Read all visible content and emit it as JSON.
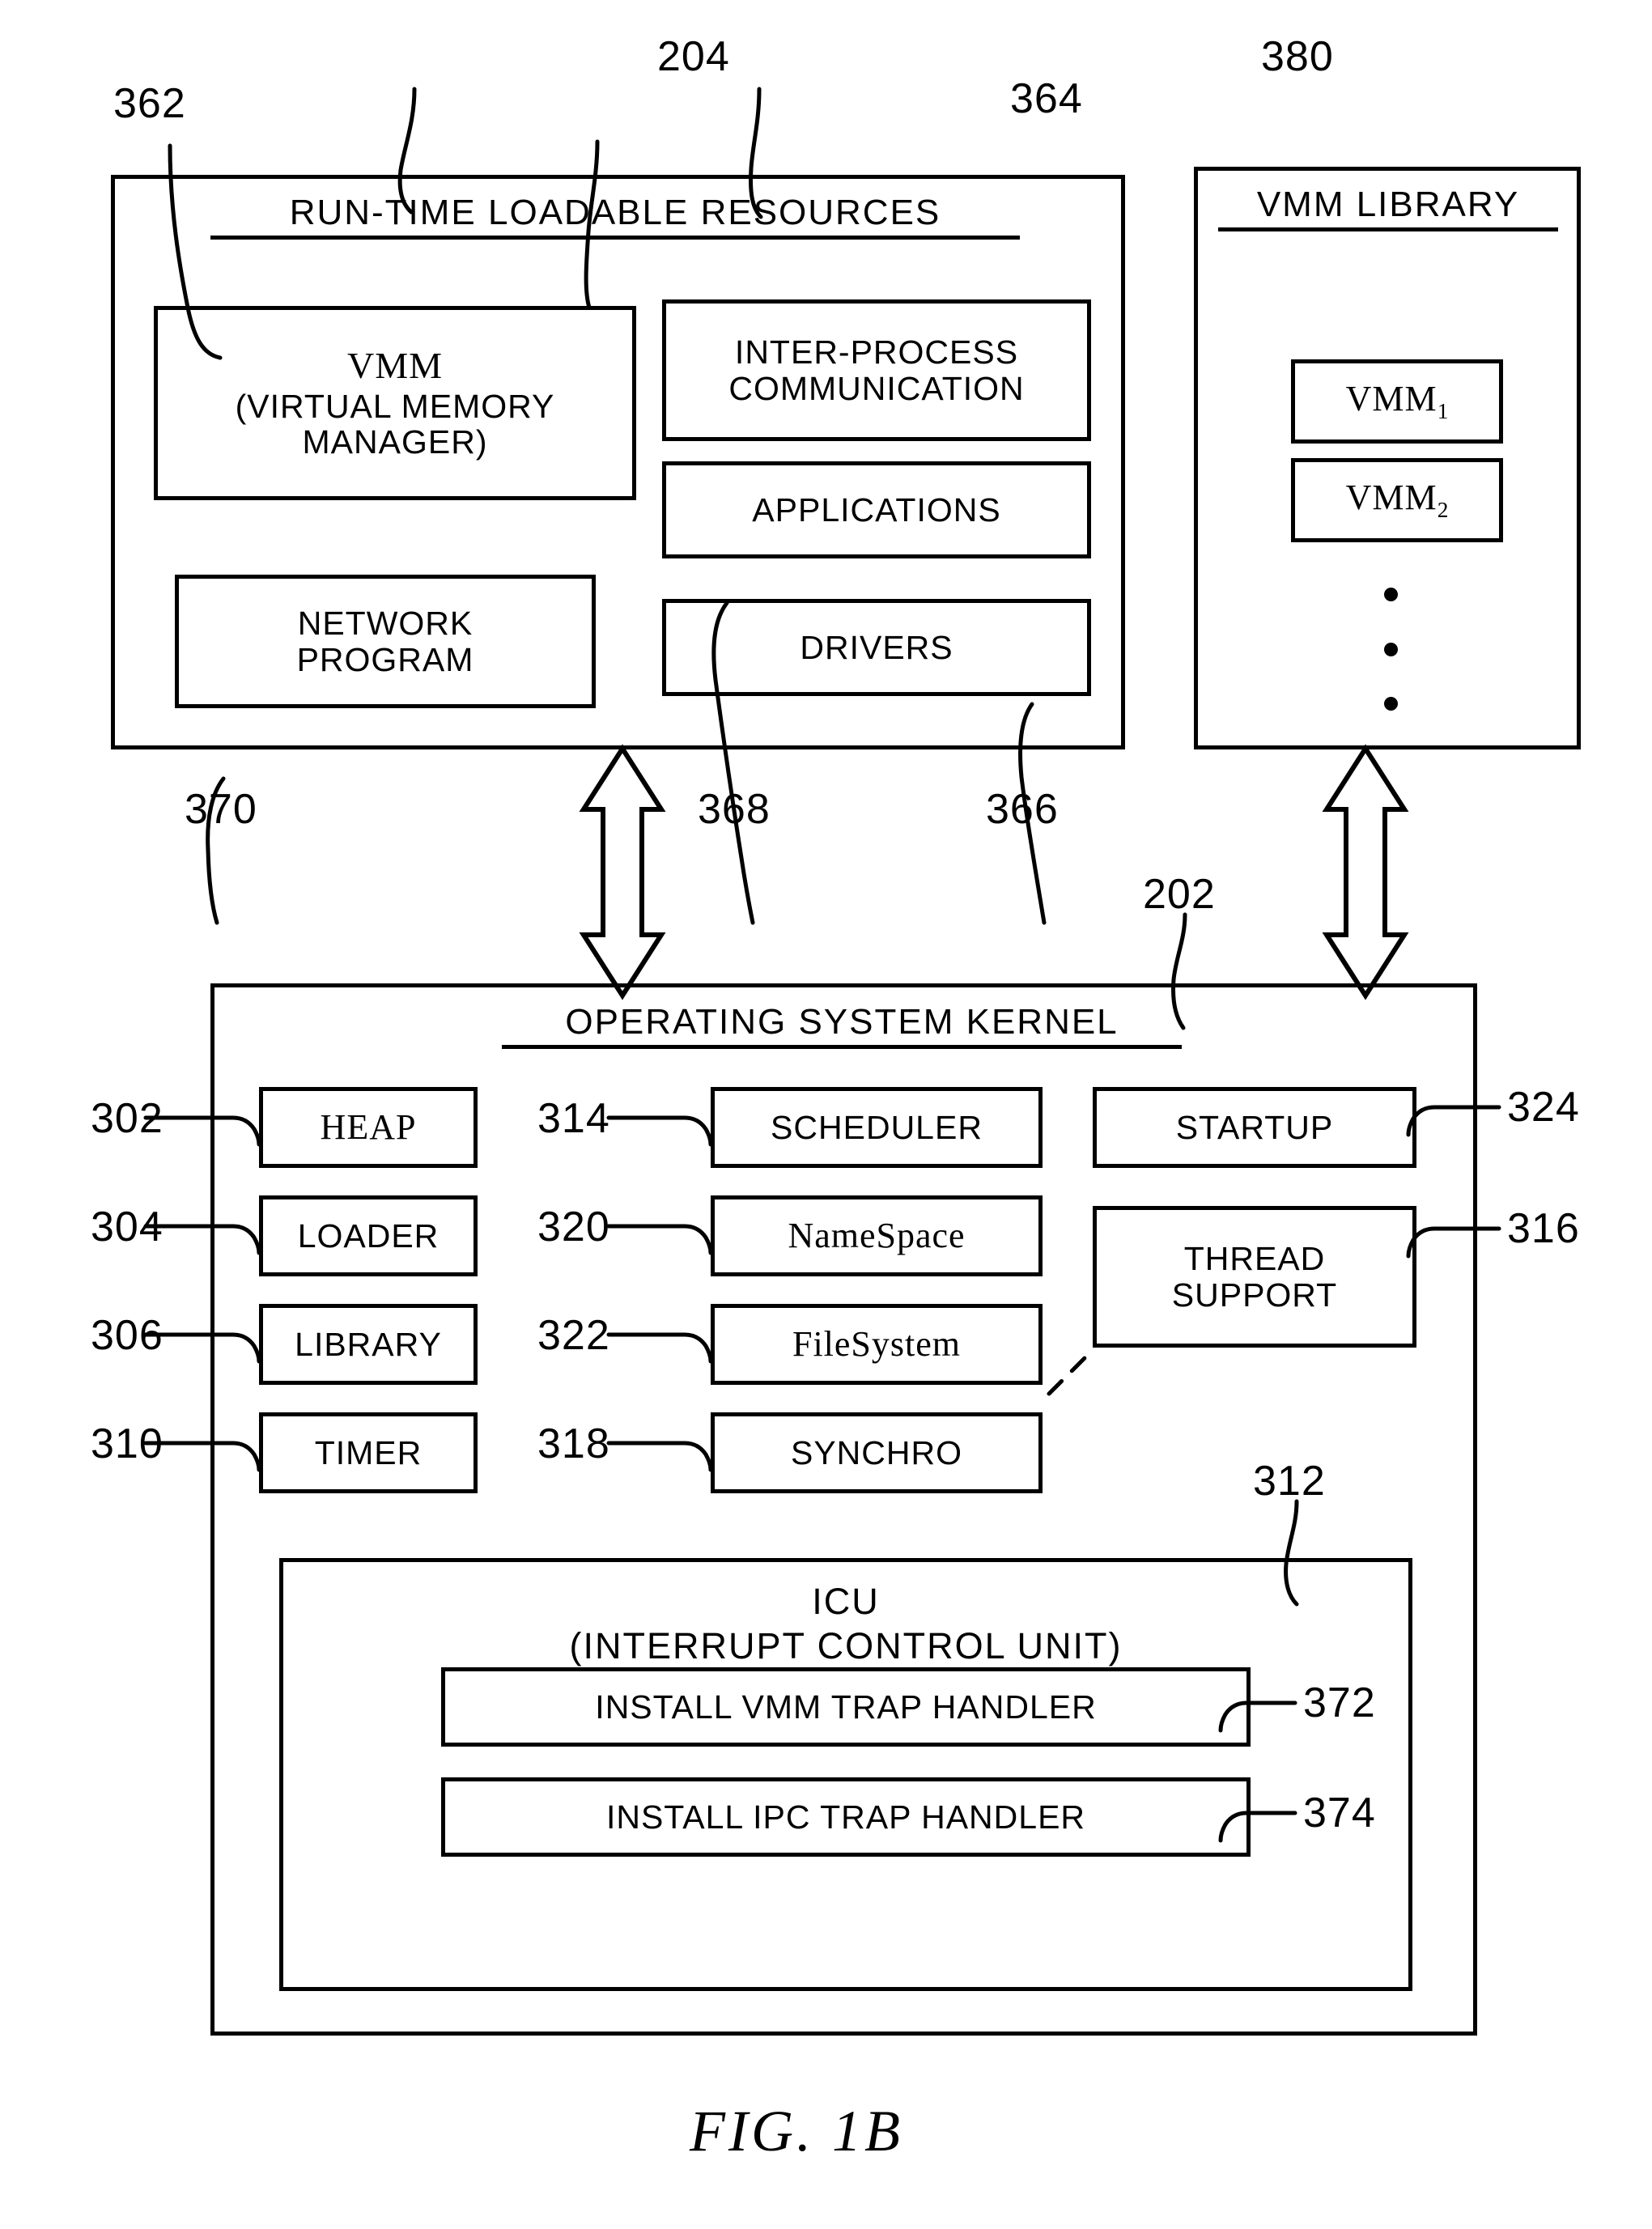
{
  "figure": {
    "caption": "FIG.  1B"
  },
  "runtime_resources": {
    "ref": "204",
    "title": "RUN-TIME  LOADABLE  RESOURCES",
    "components": [
      {
        "ref": "362",
        "name": "vmm",
        "line1": "VMM",
        "line2": "(VIRTUAL  MEMORY",
        "line3": "MANAGER)"
      },
      {
        "ref": "370",
        "name": "network-program",
        "line1": "NETWORK",
        "line2": "PROGRAM"
      },
      {
        "ref": "364",
        "name": "inter-process-communication",
        "line1": "INTER-PROCESS",
        "line2": "COMMUNICATION"
      },
      {
        "ref": "368",
        "name": "applications",
        "line1": "APPLICATIONS"
      },
      {
        "ref": "366",
        "name": "drivers",
        "line1": "DRIVERS"
      }
    ]
  },
  "vmm_library": {
    "ref": "380",
    "title": "VMM  LIBRARY",
    "entries": [
      {
        "base": "VMM",
        "index": "1"
      },
      {
        "base": "VMM",
        "index": "2"
      }
    ],
    "continuation": "vertical-ellipsis"
  },
  "kernel": {
    "ref": "202",
    "title": "OPERATING  SYSTEM  KERNEL",
    "column_left": [
      {
        "ref": "302",
        "label": "HEAP",
        "font": "serif"
      },
      {
        "ref": "304",
        "label": "LOADER",
        "font": "sans"
      },
      {
        "ref": "306",
        "label": "LIBRARY",
        "font": "sans"
      },
      {
        "ref": "310",
        "label": "TIMER",
        "font": "sans"
      }
    ],
    "column_middle": [
      {
        "ref": "314",
        "label": "SCHEDULER",
        "font": "sans"
      },
      {
        "ref": "320",
        "label": "NameSpace",
        "font": "serif"
      },
      {
        "ref": "322",
        "label": "FileSystem",
        "font": "serif"
      },
      {
        "ref": "318",
        "label": "SYNCHRO",
        "font": "sans"
      }
    ],
    "column_right": [
      {
        "ref": "324",
        "label": "STARTUP",
        "font": "sans"
      },
      {
        "ref": "316",
        "label_line1": "THREAD",
        "label_line2": "SUPPORT",
        "font": "sans"
      }
    ],
    "icu": {
      "ref": "312",
      "title_line1": "ICU",
      "title_line2": "(INTERRUPT  CONTROL  UNIT)",
      "handlers": [
        {
          "ref": "372",
          "label": "INSTALL  VMM  TRAP  HANDLER"
        },
        {
          "ref": "374",
          "label": "INSTALL  IPC  TRAP  HANDLER"
        }
      ]
    }
  },
  "connectors": [
    {
      "name": "resources-to-kernel-arrow",
      "type": "double-headed-vertical-arrow"
    },
    {
      "name": "library-to-kernel-arrow",
      "type": "double-headed-vertical-arrow"
    },
    {
      "name": "filesystem-thread-support-link",
      "type": "dashed-diagonal"
    }
  ],
  "style": {
    "stroke": "#000000",
    "background": "#ffffff"
  }
}
